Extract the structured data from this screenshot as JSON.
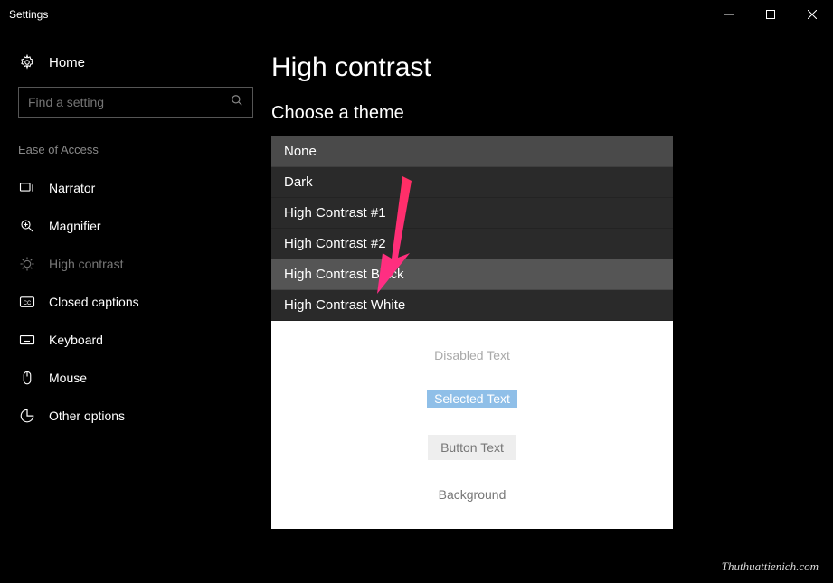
{
  "window": {
    "title": "Settings"
  },
  "sidebar": {
    "home": "Home",
    "search_placeholder": "Find a setting",
    "category": "Ease of Access",
    "items": [
      {
        "label": "Narrator"
      },
      {
        "label": "Magnifier"
      },
      {
        "label": "High contrast",
        "active": true
      },
      {
        "label": "Closed captions"
      },
      {
        "label": "Keyboard"
      },
      {
        "label": "Mouse"
      },
      {
        "label": "Other options"
      }
    ]
  },
  "main": {
    "title": "High contrast",
    "choose_theme": "Choose a theme",
    "themes": [
      "None",
      "Dark",
      "High Contrast #1",
      "High Contrast #2",
      "High Contrast Black",
      "High Contrast White"
    ],
    "selected_theme": "None",
    "hover_theme": "High Contrast Black",
    "preview": {
      "disabled": "Disabled Text",
      "selected": "Selected Text",
      "button": "Button Text",
      "background": "Background"
    }
  },
  "watermark": "Thuthuattienich.com"
}
